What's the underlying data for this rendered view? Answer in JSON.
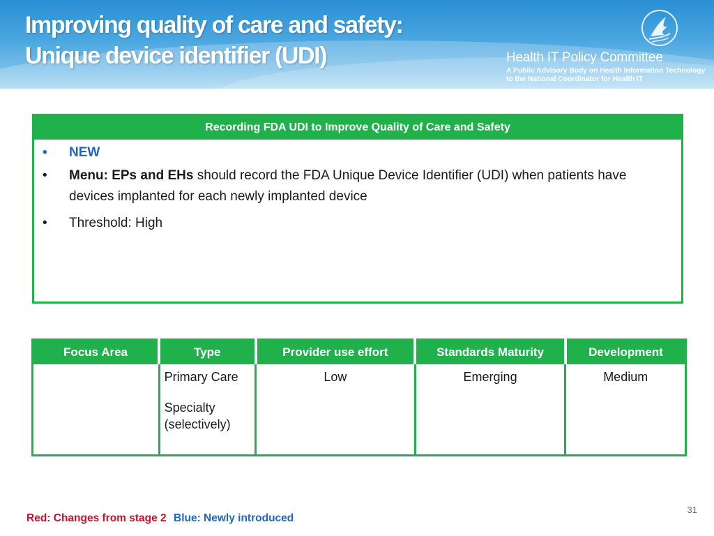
{
  "header": {
    "title_line1": "Improving quality of care and safety:",
    "title_line2": "Unique device identifier (UDI)",
    "org_name": "Health IT Policy Committee",
    "org_sub_line1": "A Public Advisory Body on Health Information Technology",
    "org_sub_line2": "to the National Coordinator for Health IT",
    "logo_icon": "hhs-eagle-icon"
  },
  "measure": {
    "heading": "Recording FDA UDI to Improve Quality of Care and Safety",
    "bullets": {
      "new_label": "NEW",
      "menu_bold": "Menu: EPs and EHs",
      "menu_text": " should record the FDA Unique Device Identifier (UDI) when patients have devices implanted for each newly implanted device",
      "threshold": "Threshold: High"
    }
  },
  "attributes": {
    "headers": [
      "Focus Area",
      "Type",
      "Provider use effort",
      "Standards Maturity",
      "Development"
    ],
    "row": {
      "focus_area": "",
      "type_1": "Primary Care",
      "type_2": "Specialty",
      "type_3": "(selectively)",
      "provider_use_effort": "Low",
      "standards_maturity": "Emerging",
      "development": "Medium"
    }
  },
  "footer": {
    "slide_number": "31",
    "legend_red": "Red: Changes from stage 2",
    "legend_blue": "Blue: Newly introduced"
  },
  "colors": {
    "header_blue": "#2a8fd3",
    "table_green": "#21b14c",
    "new_blue": "#1f66c8",
    "change_red": "#c8102e"
  }
}
